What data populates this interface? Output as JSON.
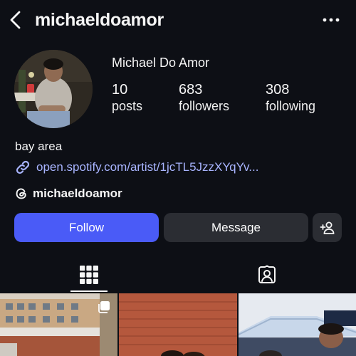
{
  "header": {
    "username": "michaeldoamor",
    "back_icon": "chevron-left-icon",
    "more_icon": "more-horizontal-icon"
  },
  "profile": {
    "display_name": "Michael Do Amor",
    "stats": {
      "posts": {
        "value": "10",
        "label": "posts"
      },
      "followers": {
        "value": "683",
        "label": "followers"
      },
      "following": {
        "value": "308",
        "label": "following"
      }
    },
    "bio": "bay area",
    "link": "open.spotify.com/artist/1jcTL5JzzXYqYv...",
    "threads_handle": "michaeldoamor"
  },
  "actions": {
    "follow_label": "Follow",
    "message_label": "Message",
    "add_user_icon": "add-user-icon"
  },
  "tabs": [
    {
      "name": "posts-grid",
      "icon": "grid-icon",
      "active": true
    },
    {
      "name": "tagged",
      "icon": "tagged-person-icon",
      "active": false
    }
  ],
  "colors": {
    "background": "#0d0f15",
    "follow_button": "#4a5bf7",
    "secondary_button": "#2b2d33",
    "link": "#a8b4ff",
    "text": "#f5f5f5"
  }
}
